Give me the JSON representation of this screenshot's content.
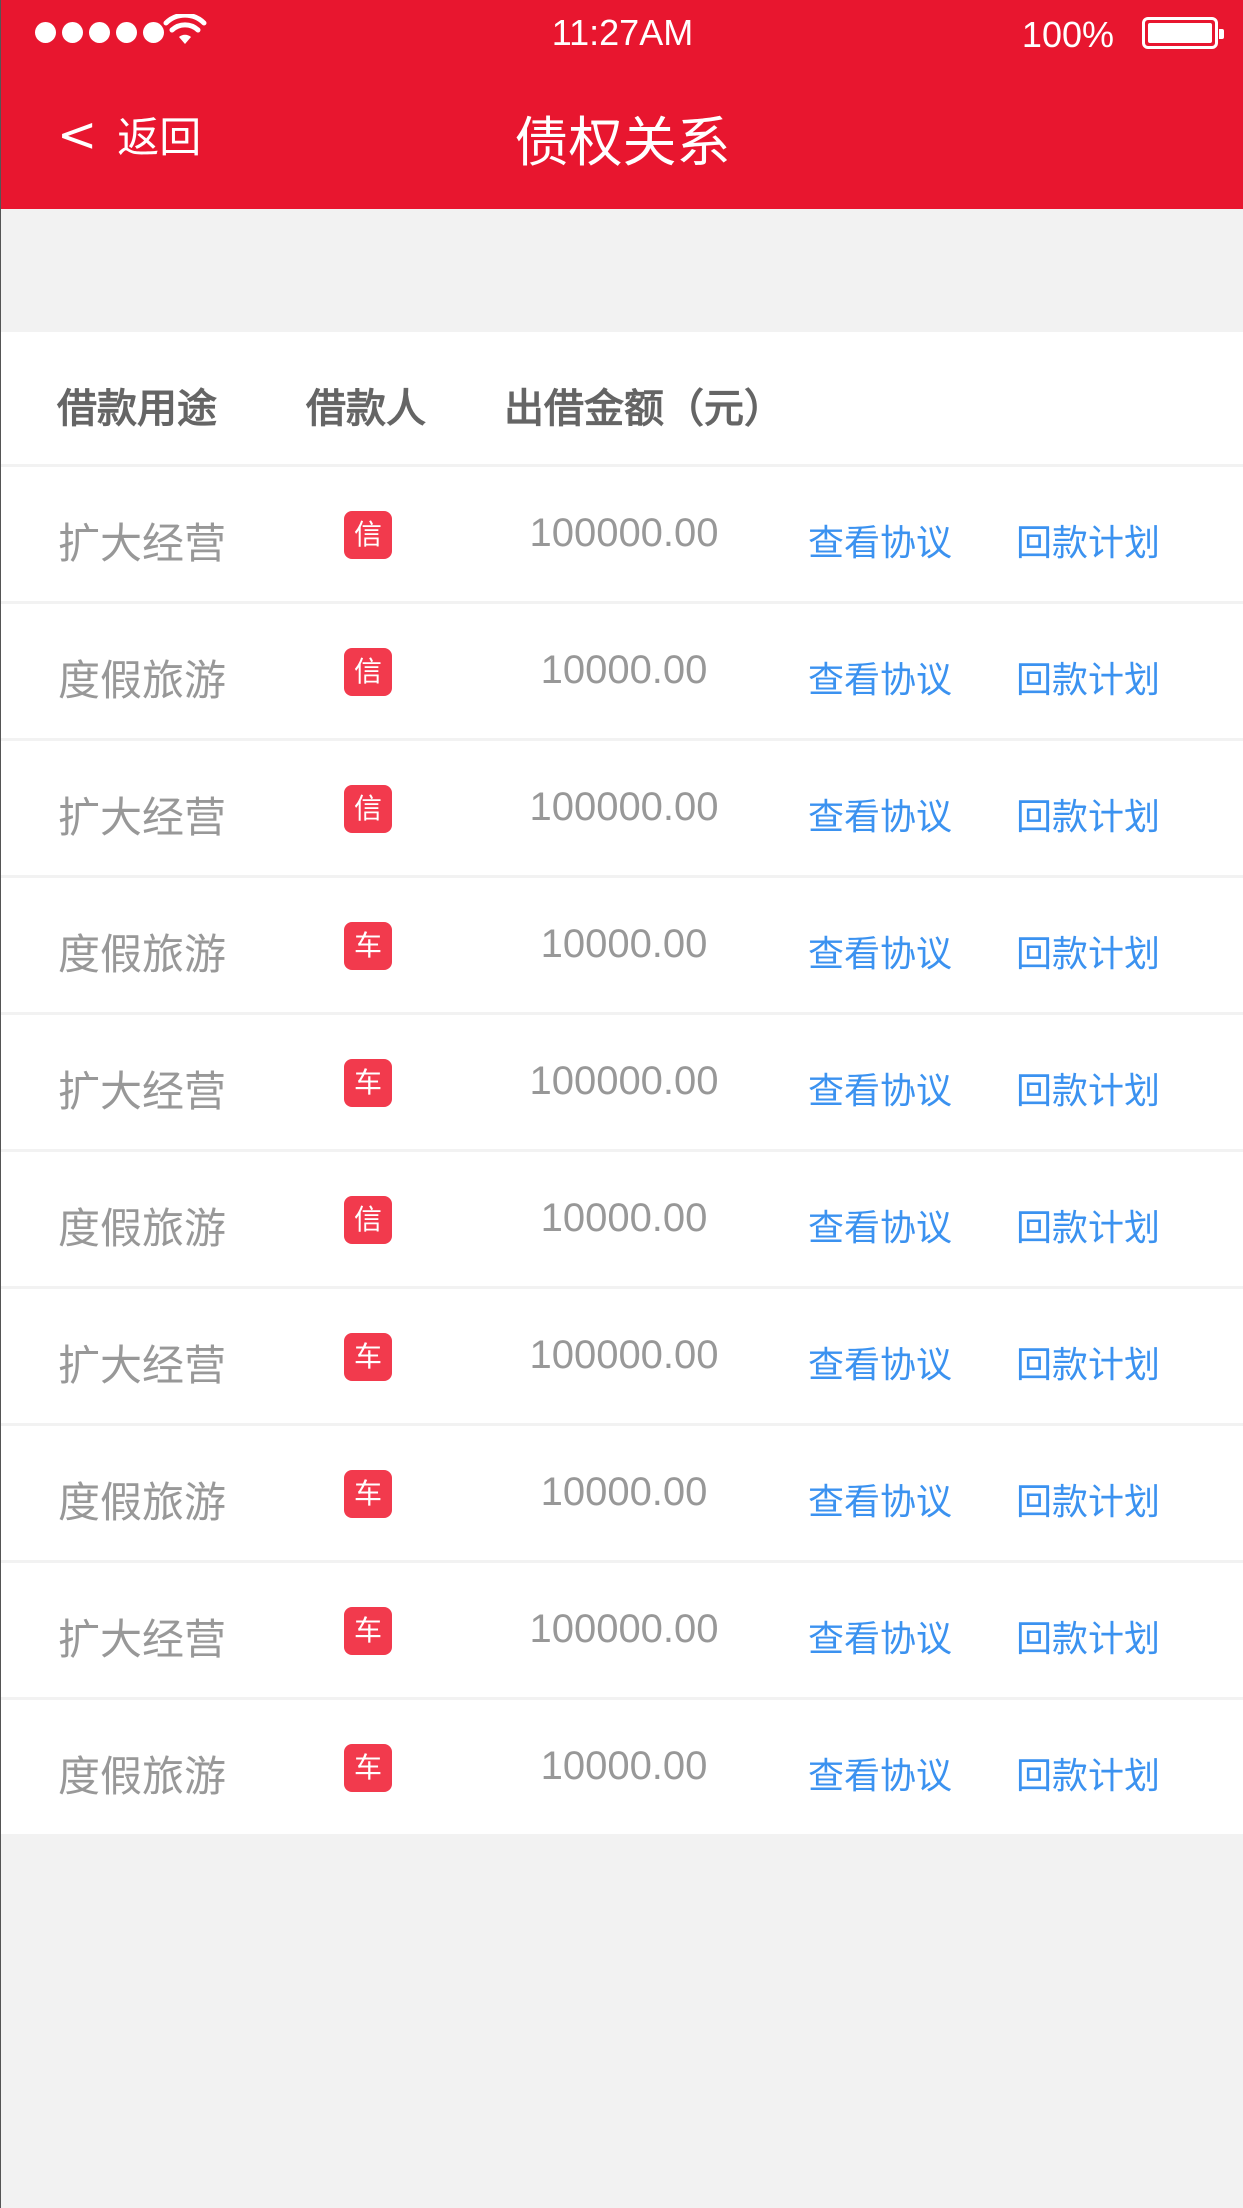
{
  "status_bar": {
    "time": "11:27AM",
    "battery": "100%",
    "signal_icon": "signal-dots-icon",
    "wifi_icon": "wifi-icon",
    "battery_icon": "battery-icon"
  },
  "nav": {
    "back_label": "返回",
    "back_icon": "chevron-left-icon",
    "title": "债权关系",
    "background_color": "#e8162f"
  },
  "table": {
    "headers": {
      "purpose": "借款用途",
      "borrower": "借款人",
      "amount": "出借金额（元）"
    },
    "rows": [
      {
        "purpose": "扩大经营",
        "badge": "信",
        "amount": "100000.00",
        "agreement": "查看协议",
        "plan": "回款计划"
      },
      {
        "purpose": "度假旅游",
        "badge": "信",
        "amount": "10000.00",
        "agreement": "查看协议",
        "plan": "回款计划"
      },
      {
        "purpose": "扩大经营",
        "badge": "信",
        "amount": "100000.00",
        "agreement": "查看协议",
        "plan": "回款计划"
      },
      {
        "purpose": "度假旅游",
        "badge": "车",
        "amount": "10000.00",
        "agreement": "查看协议",
        "plan": "回款计划"
      },
      {
        "purpose": "扩大经营",
        "badge": "车",
        "amount": "100000.00",
        "agreement": "查看协议",
        "plan": "回款计划"
      },
      {
        "purpose": "度假旅游",
        "badge": "信",
        "amount": "10000.00",
        "agreement": "查看协议",
        "plan": "回款计划"
      },
      {
        "purpose": "扩大经营",
        "badge": "车",
        "amount": "100000.00",
        "agreement": "查看协议",
        "plan": "回款计划"
      },
      {
        "purpose": "度假旅游",
        "badge": "车",
        "amount": "10000.00",
        "agreement": "查看协议",
        "plan": "回款计划"
      },
      {
        "purpose": "扩大经营",
        "badge": "车",
        "amount": "100000.00",
        "agreement": "查看协议",
        "plan": "回款计划"
      },
      {
        "purpose": "度假旅游",
        "badge": "车",
        "amount": "10000.00",
        "agreement": "查看协议",
        "plan": "回款计划"
      }
    ]
  },
  "colors": {
    "header_text": "#656565",
    "body_text": "#989898",
    "link": "#3b92f0",
    "badge": "#f23a4d",
    "divider": "#f2f2f2"
  }
}
